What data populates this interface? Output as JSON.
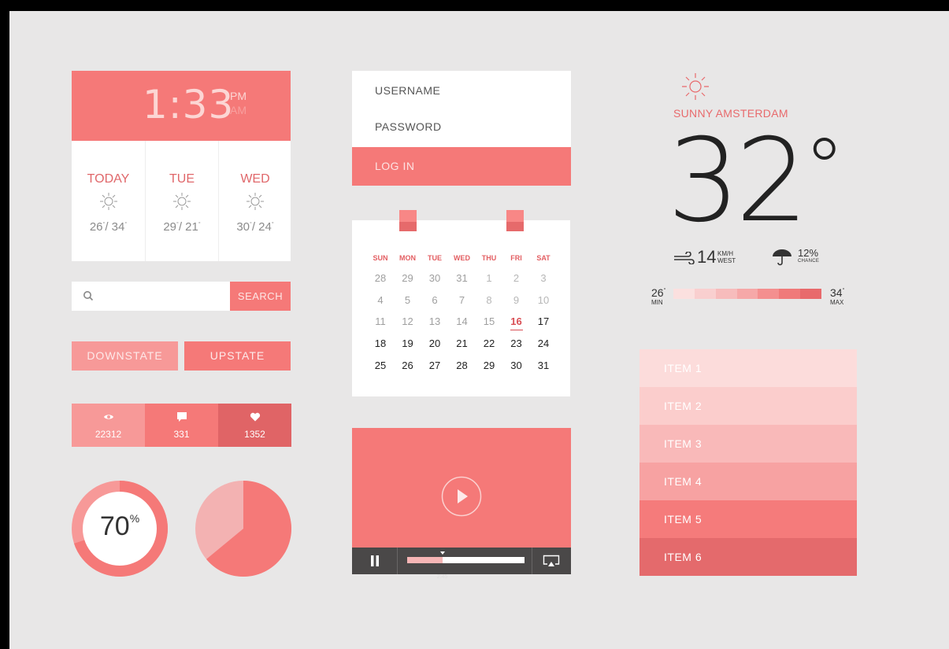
{
  "clock": {
    "time": "1:33",
    "pm": "PM",
    "am": "AM",
    "forecast": [
      {
        "day": "TODAY",
        "low": "26",
        "high": "34"
      },
      {
        "day": "TUE",
        "low": "29",
        "high": "21"
      },
      {
        "day": "WED",
        "low": "30",
        "high": "24"
      }
    ]
  },
  "search": {
    "placeholder": "",
    "button_label": "SEARCH"
  },
  "state_buttons": {
    "downstate": "DOWNSTATE",
    "upstate": "UPSTATE"
  },
  "stats": {
    "views": "22312",
    "comments": "331",
    "likes": "1352"
  },
  "donut": {
    "value": "70",
    "unit": "%",
    "fraction": 0.7
  },
  "pie": {
    "fraction": 0.64
  },
  "login": {
    "username_placeholder": "USERNAME",
    "password_placeholder": "PASSWORD",
    "button_label": "LOG IN"
  },
  "calendar": {
    "weekdays": [
      "SUN",
      "MON",
      "TUE",
      "WED",
      "THU",
      "FRI",
      "SAT"
    ],
    "weeks": [
      [
        "28",
        "29",
        "30",
        "31",
        "1",
        "2",
        "3"
      ],
      [
        "4",
        "5",
        "6",
        "7",
        "8",
        "9",
        "10"
      ],
      [
        "11",
        "12",
        "13",
        "14",
        "15",
        "16",
        "17"
      ],
      [
        "18",
        "19",
        "20",
        "21",
        "22",
        "23",
        "24"
      ],
      [
        "25",
        "26",
        "27",
        "28",
        "29",
        "30",
        "31"
      ]
    ],
    "today": "16"
  },
  "video": {
    "time": "2:45",
    "progress": 0.3
  },
  "weather": {
    "city": "SUNNY AMSTERDAM",
    "temperature": "32",
    "degree": "°",
    "wind_speed": "14",
    "wind_unit": "KM/H",
    "wind_dir": "WEST",
    "rain_chance": "12%",
    "rain_label": "CHANCE",
    "min": "26",
    "min_label": "MIN",
    "max": "34",
    "max_label": "MAX"
  },
  "items": [
    "ITEM 1",
    "ITEM 2",
    "ITEM 3",
    "ITEM 4",
    "ITEM 5",
    "ITEM 6"
  ],
  "colors": {
    "accent": "#f57978",
    "accent_dark": "#e06466",
    "background": "#e8e7e7"
  }
}
